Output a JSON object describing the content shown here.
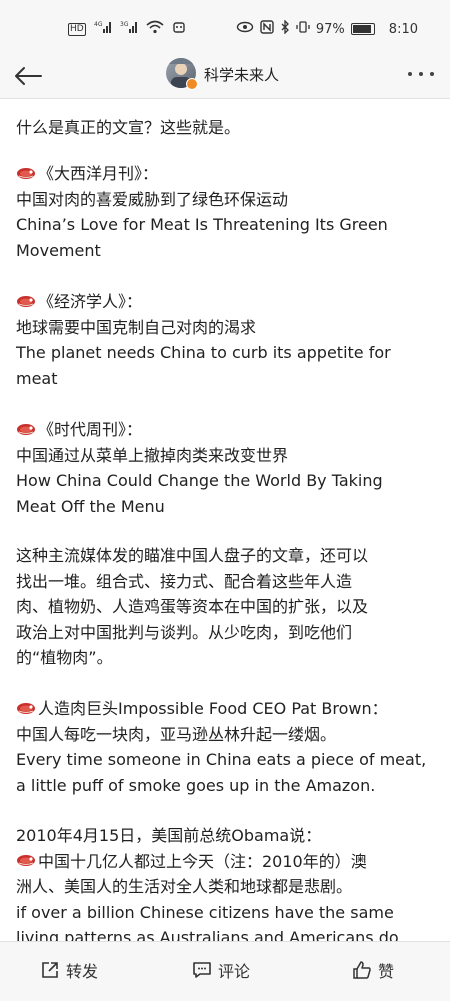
{
  "status_bar": {
    "left_icons": [
      "HD",
      "4G",
      "3G",
      "wifi",
      "app-notification"
    ],
    "right_icons": [
      "eye",
      "nfc",
      "bluetooth",
      "vibrate"
    ],
    "battery": "97%",
    "time": "8:10"
  },
  "header": {
    "author": "科学未来人"
  },
  "content": {
    "intro": "什么是真正的文宣？这些就是。",
    "source1": {
      "title": "《大西洋月刊》：",
      "zh": "中国对肉的喜爱威胁到了绿色环保运动",
      "en_1": "China’s Love for Meat Is Threatening Its Green",
      "en_2": "Movement"
    },
    "source2": {
      "title": "《经济学人》：",
      "zh": "地球需要中国克制自己对肉的渴求",
      "en_1": "The planet needs China to curb its appetite for",
      "en_2": "meat"
    },
    "source3": {
      "title": "《时代周刊》：",
      "zh": "中国通过从菜单上撤掉肉类来改变世界",
      "en_1": "How China Could Change the World By Taking",
      "en_2": "Meat Off the Menu"
    },
    "commentary": [
      "这种主流媒体发的瞄准中国人盘子的文章，还可以",
      "找出一堆。组合式、接力式、配合着这些年人造",
      "肉、植物奶、人造鸡蛋等资本在中国的扩张，以及",
      "政治上对中国批判与谈判。从少吃肉，到吃他们",
      "的“植物肉”。"
    ],
    "quote1": {
      "title": "人造肉巨头Impossible Food CEO Pat Brown：",
      "zh": "中国人每吃一块肉，亚马逊丛林升起一缕烟。",
      "en_1": "Every time someone in China eats a piece of meat,",
      "en_2": "a little puff of smoke goes up in the Amazon."
    },
    "quote2": {
      "intro": "2010年4月15日，美国前总统Obama说：",
      "zh_1": "中国十几亿人都过上今天（注：2010年的）澳",
      "zh_2": "洲人、美国人的生活对全人类和地球都是悲剧。",
      "en_1": "if over a billion Chinese citizens have the same",
      "en_2": "living patterns as Australians and Americans do"
    }
  },
  "actions": {
    "repost": "转发",
    "comment": "评论",
    "like": "赞"
  }
}
